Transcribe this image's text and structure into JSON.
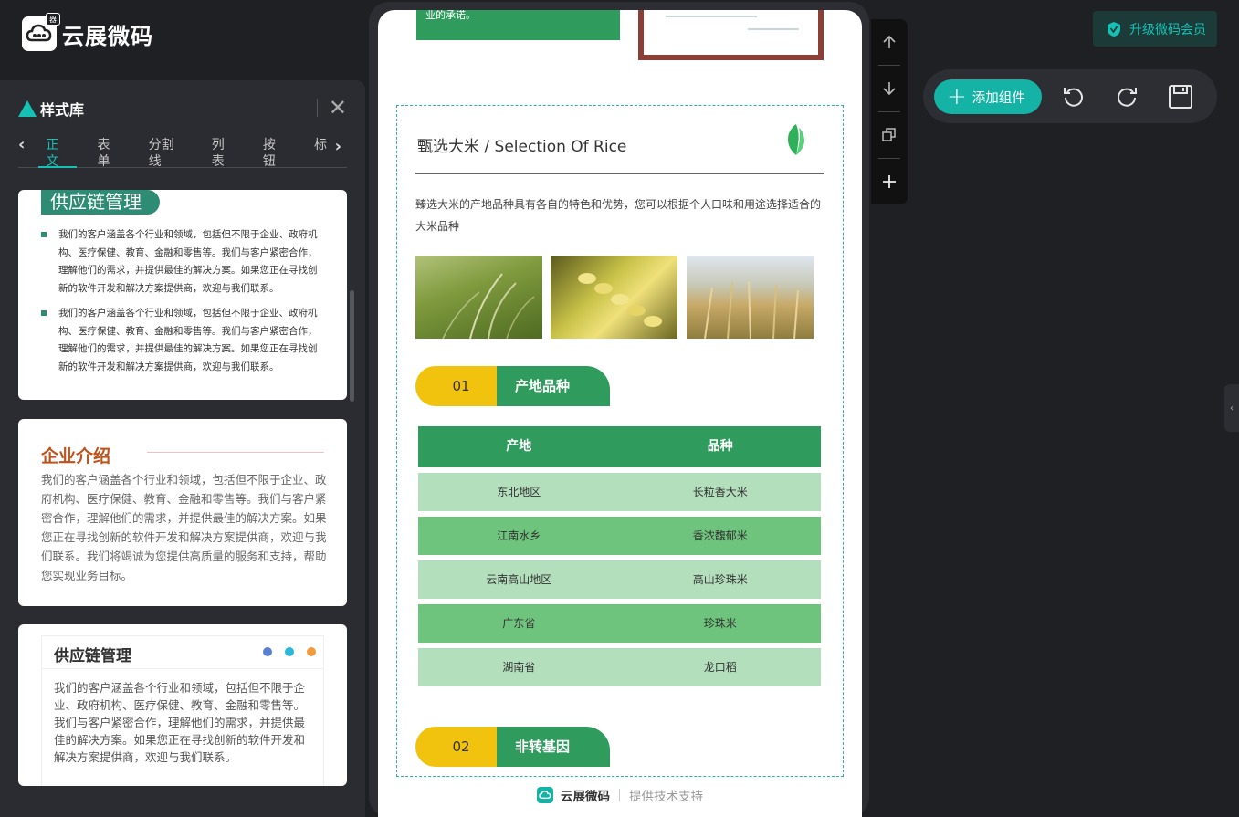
{
  "brand": {
    "name": "云展微码",
    "badge_text": "器"
  },
  "style_library": {
    "title": "样式库",
    "tabs": [
      {
        "label": "正文",
        "active": true
      },
      {
        "label": "表单"
      },
      {
        "label": "分割线"
      },
      {
        "label": "列表"
      },
      {
        "label": "按钮"
      },
      {
        "label": "标"
      }
    ],
    "cards": [
      {
        "heading": "供应链管理",
        "items": [
          "我们的客户涵盖各个行业和领域，包括但不限于企业、政府机构、医疗保健、教育、金融和零售等。我们与客户紧密合作，理解他们的需求，并提供最佳的解决方案。如果您正在寻找创新的软件开发和解决方案提供商，欢迎与我们联系。",
          "我们的客户涵盖各个行业和领域，包括但不限于企业、政府机构、医疗保健、教育、金融和零售等。我们与客户紧密合作，理解他们的需求，并提供最佳的解决方案。如果您正在寻找创新的软件开发和解决方案提供商，欢迎与我们联系。"
        ]
      },
      {
        "heading": "企业介绍",
        "text": "我们的客户涵盖各个行业和领域，包括但不限于企业、政府机构、医疗保健、教育、金融和零售等。我们与客户紧密合作，理解他们的需求，并提供最佳的解决方案。如果您正在寻找创新的软件开发和解决方案提供商，欢迎与我们联系。我们将竭诚为您提供高质量的服务和支持，帮助您实现业务目标。"
      },
      {
        "heading": "供应链管理",
        "text": "我们的客户涵盖各个行业和领域，包括但不限于企业、政府机构、医疗保健、教育、金融和零售等。我们与客户紧密合作，理解他们的需求，并提供最佳的解决方案。如果您正在寻找创新的软件开发和解决方案提供商，欢迎与我们联系。",
        "dot_colors": [
          "#5b7fd1",
          "#2ab7d8",
          "#f29b3c"
        ]
      }
    ]
  },
  "preview": {
    "top_snippet": "业的承诺。",
    "section": {
      "title": "甄选大米 / Selection Of Rice",
      "description": "臻选大米的产地品种具有各自的特色和优势，您可以根据个人口味和用途选择适合的大米品种",
      "photos": [
        "rice-field-photo",
        "wheat-ear-photo",
        "wheat-field-photo"
      ]
    },
    "pills": [
      {
        "number": "01",
        "label": "产地品种"
      },
      {
        "number": "02",
        "label": "非转基因"
      }
    ],
    "table": {
      "headers": [
        "产地",
        "品种"
      ],
      "rows": [
        [
          "东北地区",
          "长粒香大米"
        ],
        [
          "江南水乡",
          "香浓馥郁米"
        ],
        [
          "云南高山地区",
          "高山珍珠米"
        ],
        [
          "广东省",
          "珍珠米"
        ],
        [
          "湖南省",
          "龙口稻"
        ]
      ]
    },
    "footer": {
      "brand": "云展微码",
      "note": "提供技术支持"
    }
  },
  "toolbar": {
    "upgrade_label": "升级微码会员",
    "add_component_label": "添加组件"
  },
  "colors": {
    "accent": "#14b3a6",
    "green": "#2f9b5d",
    "yellow": "#f1c30f",
    "row_light": "#b4dfbd",
    "row_dark": "#6ec47c"
  }
}
